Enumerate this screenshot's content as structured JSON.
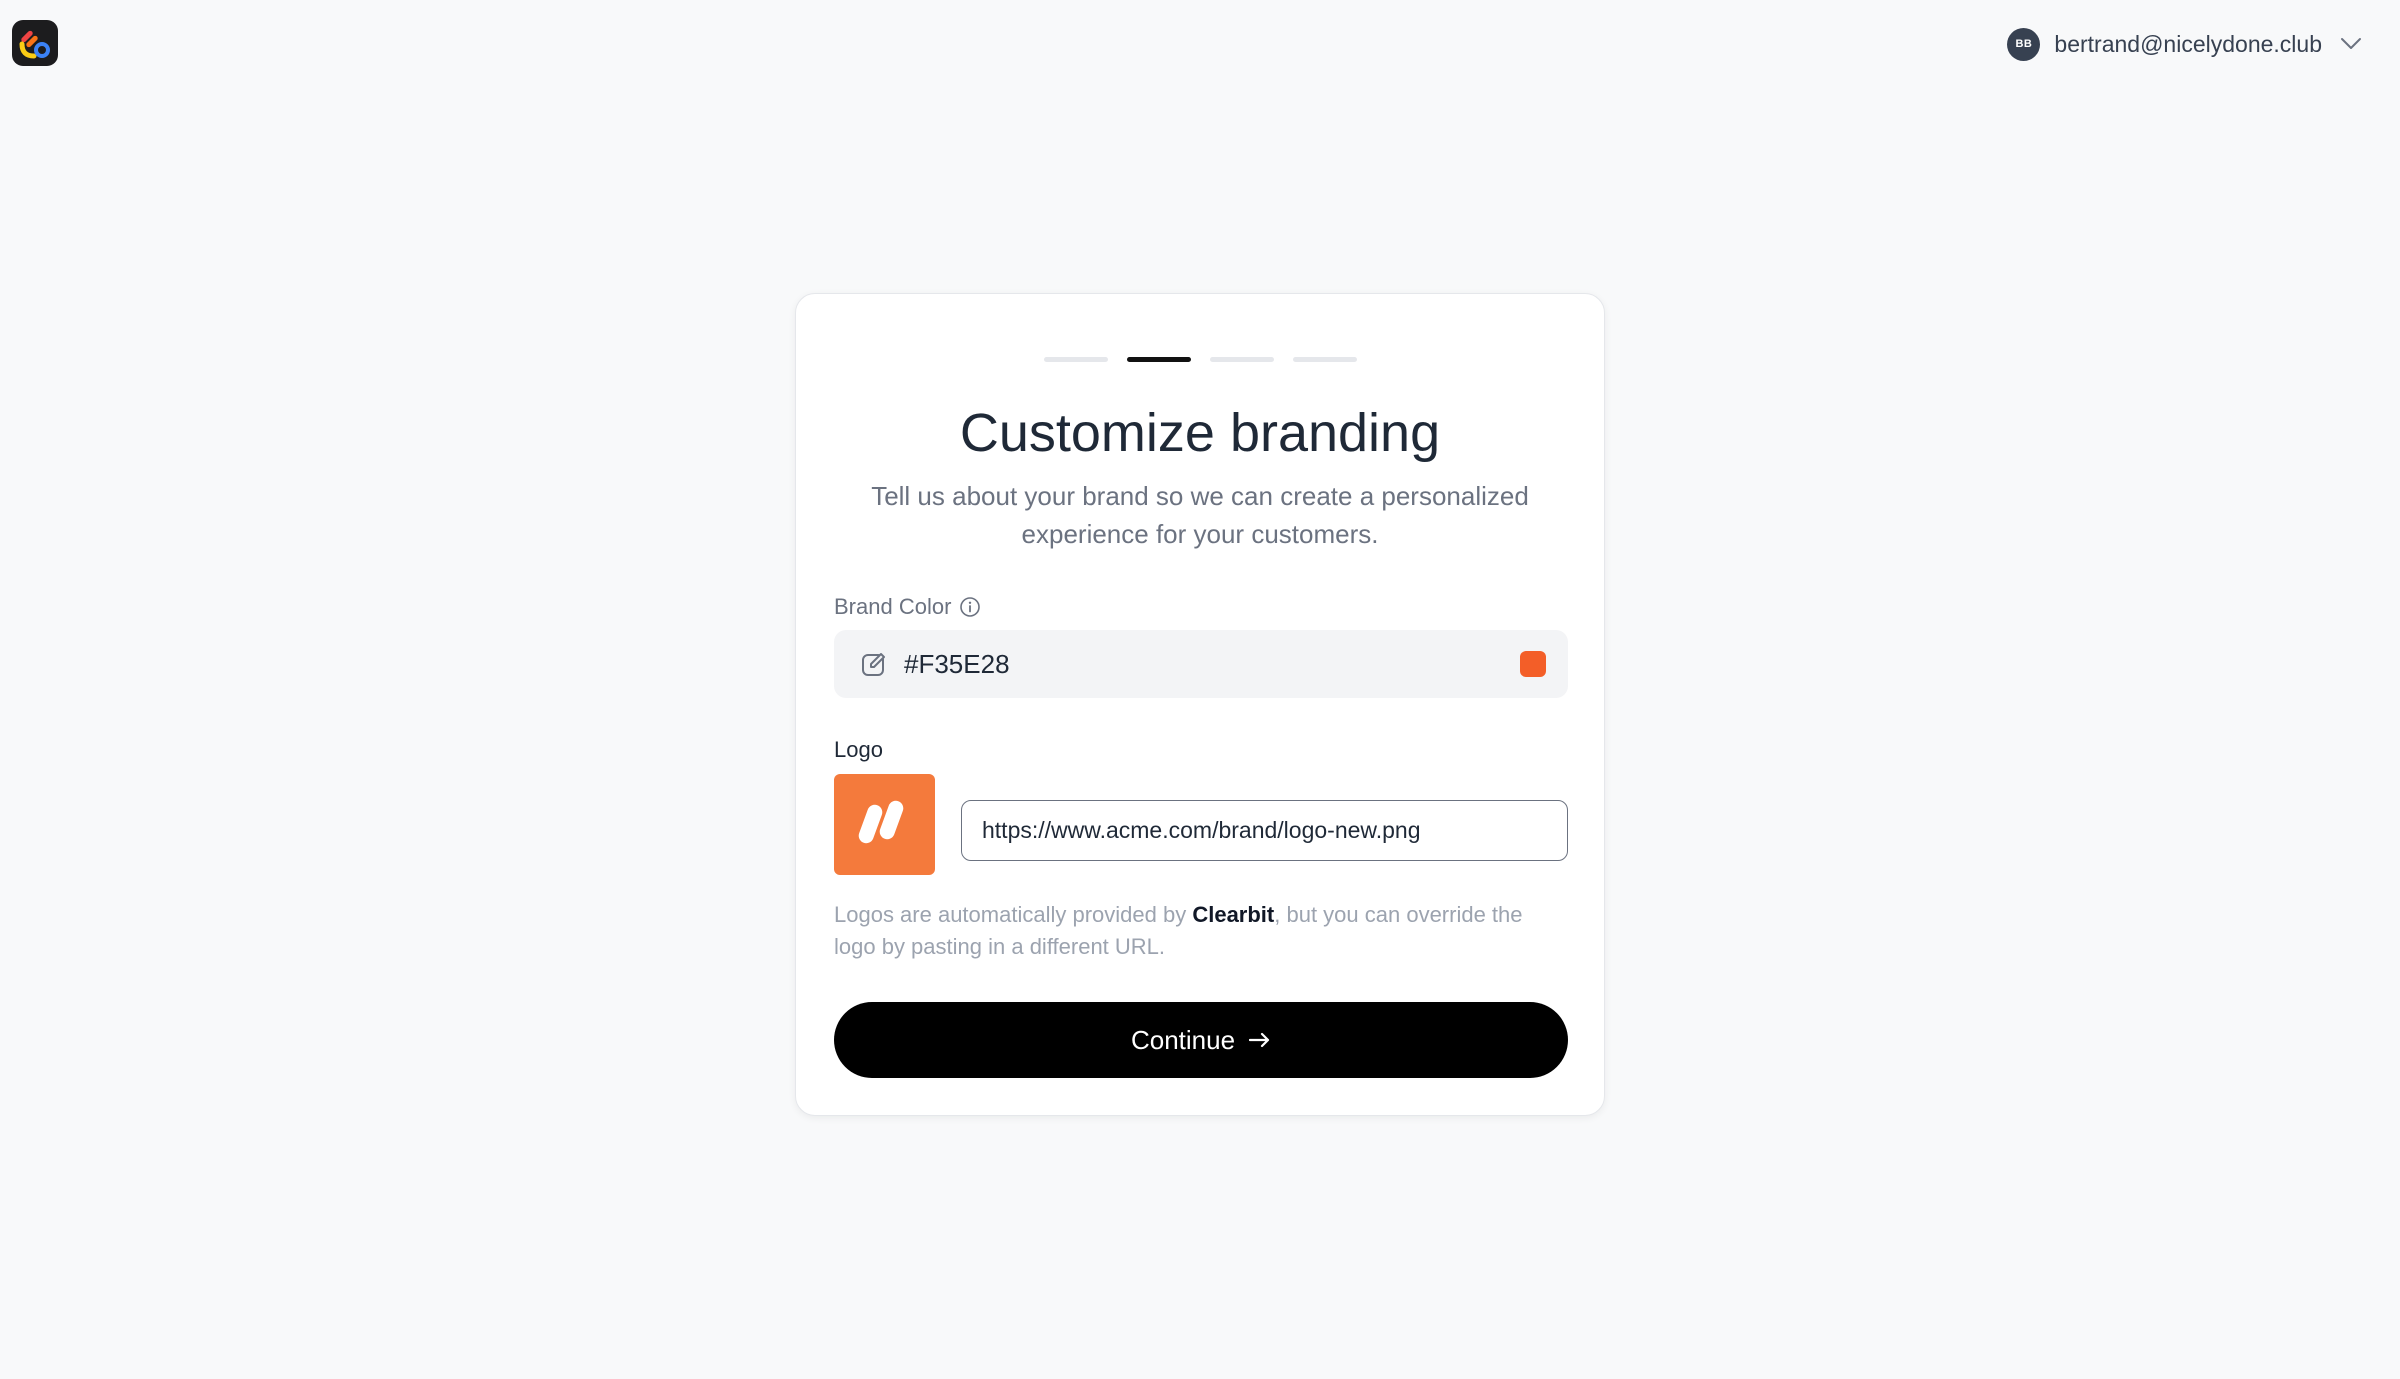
{
  "header": {
    "account": {
      "initials": "BB",
      "email": "bertrand@nicelydone.club"
    }
  },
  "onboarding": {
    "steps_total": 4,
    "current_step": 2,
    "title": "Customize branding",
    "subtitle": "Tell us about your brand so we can create a personalized experience for your customers.",
    "brand_color": {
      "label": "Brand Color",
      "value": "#F35E28"
    },
    "logo": {
      "label": "Logo",
      "url_value": "https://www.acme.com/brand/logo-new.png",
      "help_prefix": "Logos are automatically provided by ",
      "help_link": "Clearbit",
      "help_suffix": ", but you can override the logo by pasting in a different URL."
    },
    "continue_label": "Continue",
    "continue_icon": "arrow-right-icon"
  },
  "colors": {
    "accent": "#F35E28",
    "logo_bg": "#F47A3C",
    "button_bg": "#000000",
    "background": "#F8F9FA"
  }
}
